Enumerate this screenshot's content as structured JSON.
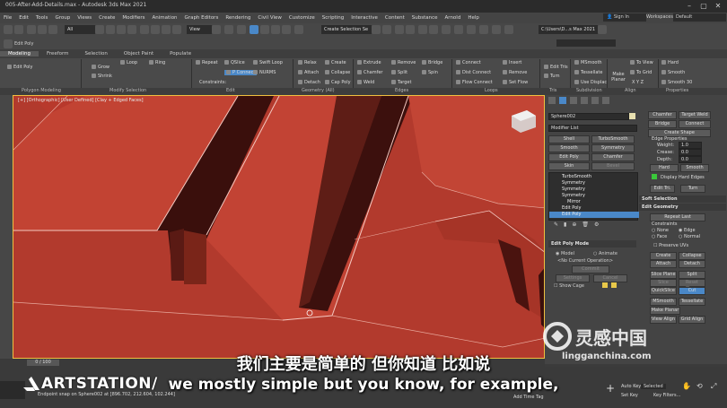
{
  "window": {
    "title": "005-After-Add-Details.max - Autodesk 3ds Max 2021"
  },
  "menu": [
    "File",
    "Edit",
    "Tools",
    "Group",
    "Views",
    "Create",
    "Modifiers",
    "Animation",
    "Graph Editors",
    "Rendering",
    "Civil View",
    "Customize",
    "Scripting",
    "Interactive",
    "Content",
    "Substance",
    "Arnold",
    "Help"
  ],
  "account": {
    "signin": "Sign In",
    "workspace_label": "Workspaces:",
    "workspace_value": "Default"
  },
  "toolbar": {
    "filter": "All",
    "view": "View",
    "selection_set": "Create Selection Se",
    "path": "C:\\Users\\D...s Max 2021",
    "edit_poly_label": "Edit Poly"
  },
  "ribbon_tabs": [
    "Modeling",
    "Freeform",
    "Selection",
    "Object Paint",
    "Populate"
  ],
  "ribbon": {
    "polygon_modeling": [
      "Edit Poly"
    ],
    "modify_selection": [
      "Grow",
      "Shrink",
      "Loop",
      "Ring"
    ],
    "edit": [
      "Repeat",
      "QSlice",
      "Swift Loop",
      "Constraints:",
      "P Connect",
      "NURMS"
    ],
    "geometry": [
      "Relax",
      "Create",
      "Attach",
      "Collapse",
      "Detach",
      "Cap Poly"
    ],
    "edges": [
      "Extrude",
      "Remove",
      "Bridge",
      "Chamfer",
      "Split",
      "Spin",
      "Weld",
      "Target"
    ],
    "loops": [
      "Connect",
      "Insert",
      "Dist Connect",
      "Remove",
      "Flow Connect",
      "Set Flow"
    ],
    "tris": [
      "Edit Tris",
      "Turn"
    ],
    "subdivision": [
      "MSmooth",
      "Tessellate",
      "Use Displac"
    ],
    "align": [
      "Make Planar",
      "To View",
      "To Grid",
      "X Y Z"
    ],
    "properties": [
      "Hard",
      "Smooth",
      "Smooth 30"
    ],
    "section_labels": [
      "Polygon Modeling",
      "Modify Selection",
      "Edit",
      "Geometry (All)",
      "Edges",
      "Loops",
      "Tris",
      "Subdivision",
      "Align",
      "Properties"
    ]
  },
  "viewport": {
    "label": "[+] [Orthographic] [User Defined] [Clay + Edged Faces]"
  },
  "command_panel": {
    "object_name": "Sphere002",
    "modifier_list": "Modifier List",
    "sets": [
      "Shell",
      "TurboSmooth",
      "Smooth",
      "Symmetry",
      "Edit Poly",
      "Chamfer",
      "Skin",
      "Bevel"
    ],
    "stack": [
      "TurboSmooth",
      "Symmetry",
      "Symmetry",
      "Symmetry",
      "Mirror",
      "Edit Poly",
      "Edit Poly"
    ],
    "edit_poly_mode": {
      "header": "Edit Poly Mode",
      "model": "Model",
      "animate": "Animate",
      "current_op": "<No Current Operation>",
      "commit": "Commit",
      "settings": "Settings",
      "cancel": "Cancel",
      "show_cage": "Show Cage"
    }
  },
  "right_panel": {
    "buttons_top": [
      "Chamfer",
      "Target Weld",
      "Bridge",
      "Connect",
      "Create Shape"
    ],
    "edge_properties": {
      "label": "Edge Properties",
      "weight": "Weight:",
      "crease": "Crease:",
      "depth": "Depth:",
      "weight_val": "1.0",
      "crease_val": "0.0",
      "depth_val": "0.0"
    },
    "hard": "Hard",
    "smooth": "Smooth",
    "display_hard_edges": "Display Hard Edges",
    "edit_tri": "Edit Tri.",
    "turn": "Turn",
    "soft_selection": "Soft Selection",
    "edit_geometry": "Edit Geometry",
    "repeat_last": "Repeat Last",
    "constraints": "Constraints",
    "none": "None",
    "edge": "Edge",
    "face": "Face",
    "normal": "Normal",
    "preserve_uvs": "Preserve UVs",
    "create": "Create",
    "collapse": "Collapse",
    "attach": "Attach",
    "detach": "Detach",
    "slice_plane": "Slice Plane",
    "split": "Split",
    "slice": "Slice",
    "reset_plane": "Reset Plane",
    "quickslice": "QuickSlice",
    "cut": "Cut",
    "msmooth": "MSmooth",
    "tessellate": "Tessellate",
    "make_planar": "Make Planar",
    "view_align": "View Align",
    "grid_align": "Grid Align"
  },
  "timeline": {
    "slider": "0 / 100"
  },
  "status": {
    "text": "Endpoint snap on Sphere002 at [896.702, 212.604, 102.244]",
    "add_time_tag": "Add Time Tag",
    "auto_key": "Auto Key",
    "set_key": "Set Key",
    "selected": "Selected",
    "key_filters": "Key Filters..."
  },
  "overlay": {
    "subtitle_cn": "我们主要是简单的 但你知道 比如说",
    "subtitle_en": "we mostly simple but you know, for example,",
    "brand": "ARTSTATION/",
    "watermark_cn": "灵感中国",
    "watermark_url": "lingganchina.com"
  },
  "colors": {
    "accent_active": "#4a88c8",
    "model_red": "#b5392c",
    "viewport_border": "#f0c040"
  }
}
